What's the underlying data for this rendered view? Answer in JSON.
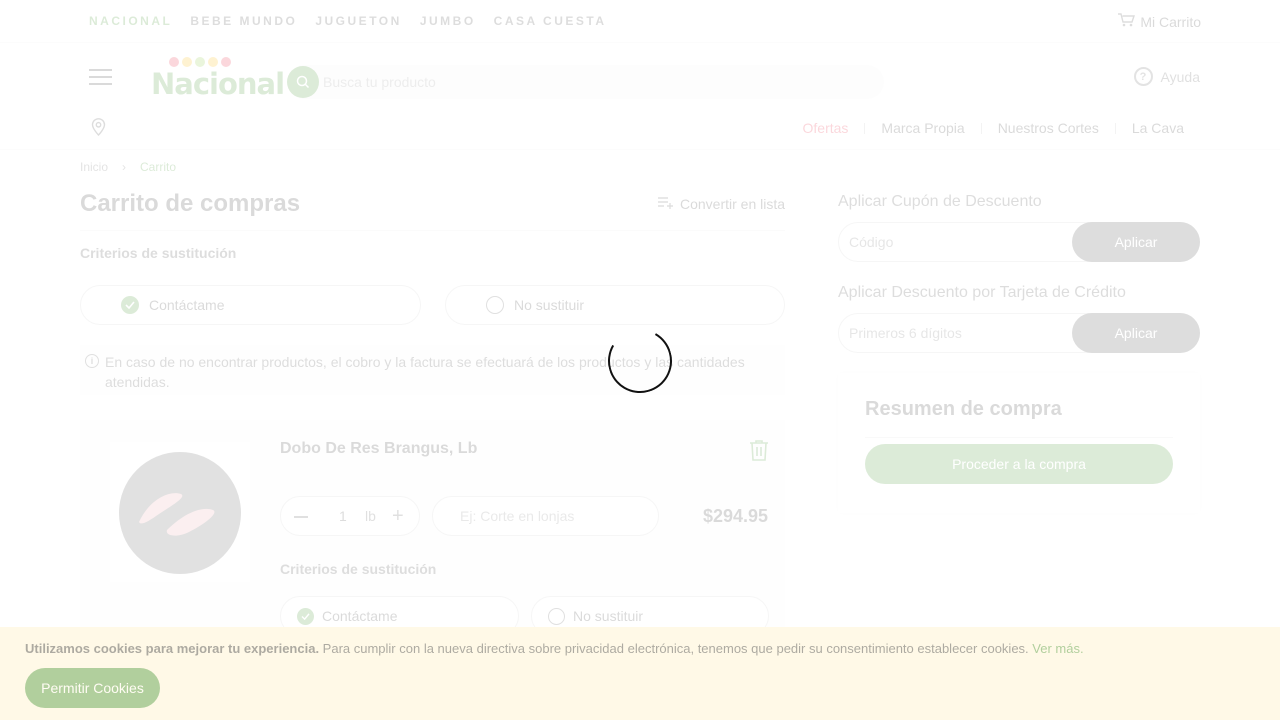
{
  "topbar": {
    "stores": [
      "NACIONAL",
      "BEBE MUNDO",
      "JUGUETON",
      "JUMBO",
      "CASA CUESTA"
    ],
    "cart_label": "Mi Carrito"
  },
  "header": {
    "logo_text": "Nacional",
    "search_placeholder": "Busca tu producto",
    "help_label": "Ayuda",
    "nav": [
      "Ofertas",
      "Marca Propia",
      "Nuestros Cortes",
      "La Cava"
    ]
  },
  "breadcrumb": [
    "Inicio",
    "Carrito"
  ],
  "cart": {
    "title": "Carrito de compras",
    "convert_label": "Convertir en lista",
    "criteria_title": "Criterios de sustitución",
    "option_contact": "Contáctame",
    "option_no_sub": "No sustituir",
    "notice": "En caso de no encontrar productos, el cobro y la factura se efectuará de los productos y las cantidades atendidas."
  },
  "product": {
    "name": "Dobo De Res Brangus, Lb",
    "quantity": "1",
    "unit": "lb",
    "note_placeholder": "Ej: Corte en lonjas",
    "price": "$294.95",
    "criteria_title": "Criterios de sustitución",
    "option_contact": "Contáctame",
    "option_no_sub": "No sustituir"
  },
  "sidebar": {
    "coupon_title": "Aplicar Cupón de Descuento",
    "coupon_placeholder": "Código",
    "coupon_button": "Aplicar",
    "card_title": "Aplicar Descuento por Tarjeta de Crédito",
    "card_placeholder": "Primeros 6 dígitos",
    "card_button": "Aplicar",
    "summary_title": "Resumen de compra",
    "checkout_button": "Proceder a la compra"
  },
  "cookie": {
    "bold": "Utilizamos cookies para mejorar tu experiencia.",
    "text": " Para cumplir con la nueva directiva sobre privacidad electrónica, tenemos que pedir su consentimiento establecer cookies. ",
    "link": "Ver más.",
    "button": "Permitir Cookies"
  },
  "colors": {
    "brand_green": "#3e8f2a",
    "offers_red": "#e8243c",
    "cookie_bg": "#fff8e0"
  }
}
